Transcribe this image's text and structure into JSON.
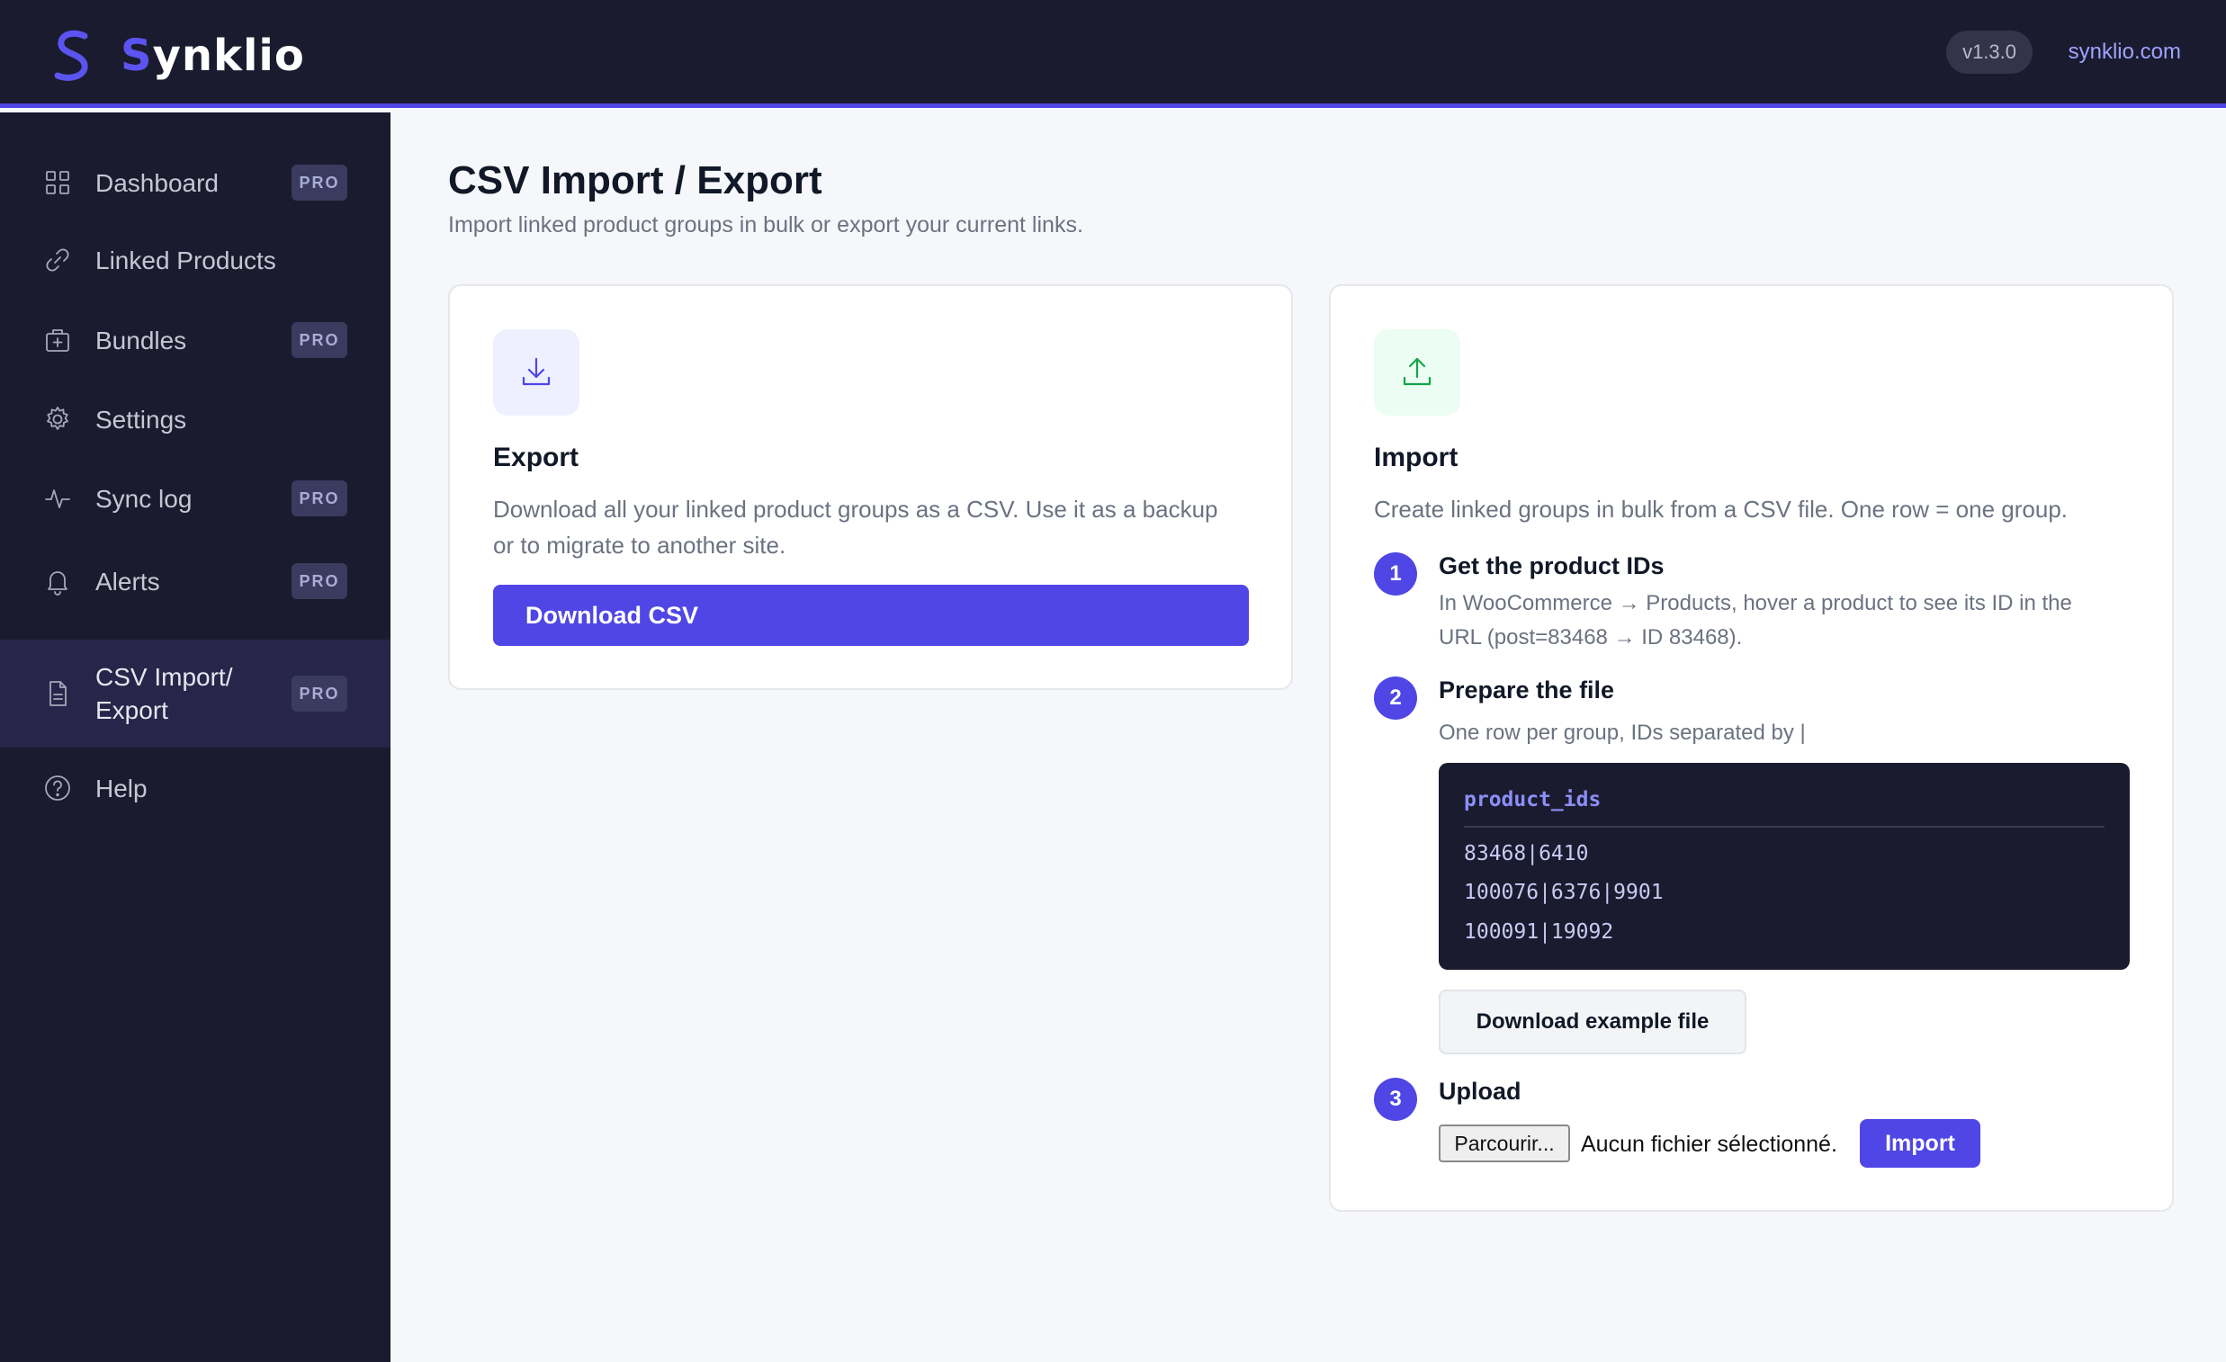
{
  "header": {
    "brand_first": "S",
    "brand_rest": "ynklio",
    "version": "v1.3.0",
    "site_link": "synklio.com"
  },
  "sidebar": {
    "items": [
      {
        "label": "Dashboard",
        "icon": "grid-icon",
        "pro": "PRO"
      },
      {
        "label": "Linked Products",
        "icon": "link-icon",
        "pro": ""
      },
      {
        "label": "Bundles",
        "icon": "box-plus-icon",
        "pro": "PRO"
      },
      {
        "label": "Settings",
        "icon": "gear-icon",
        "pro": ""
      },
      {
        "label": "Sync log",
        "icon": "activity-icon",
        "pro": "PRO"
      },
      {
        "label": "Alerts",
        "icon": "bell-icon",
        "pro": "PRO"
      },
      {
        "label_line1": "CSV Import/",
        "label_line2": "Export",
        "icon": "file-icon",
        "pro": "PRO",
        "active": true
      },
      {
        "label": "Help",
        "icon": "help-circle-icon",
        "pro": ""
      }
    ]
  },
  "main": {
    "title": "CSV Import / Export",
    "subtitle": "Import linked product groups in bulk or export your current links."
  },
  "export_card": {
    "icon": "download-icon",
    "title": "Export",
    "desc_line1": "Download all your linked product groups as a CSV. Use it as a backup",
    "desc_line2": "or to migrate to another site.",
    "button": "Download CSV"
  },
  "import_card": {
    "icon": "upload-icon",
    "title": "Import",
    "desc": "Create linked groups in bulk from a CSV file. One row = one group.",
    "steps": [
      {
        "num": "1",
        "title": "Get the product IDs",
        "text_line1": "In WooCommerce → Products, hover a product to see its ID in the",
        "text_line2": "URL (post=83468 → ID 83468)."
      },
      {
        "num": "2",
        "title": "Prepare the file",
        "text_line1": "One row per group, IDs separated by |"
      },
      {
        "num": "3",
        "title": "Upload"
      }
    ],
    "code": {
      "header": "product_ids",
      "rows": [
        "83468|6410",
        "100076|6376|9901",
        "100091|19092"
      ]
    },
    "example_button": "Download example file",
    "file_button": "Parcourir...",
    "file_status": "Aucun fichier sélectionné.",
    "import_button": "Import"
  },
  "colors": {
    "accent": "#4f46e5",
    "sidebar_bg": "#1b1b2f",
    "page_bg": "#f6f7fb",
    "export_icon_bg": "#eef0ff",
    "import_icon_bg": "#ecfdf3",
    "import_icon_stroke": "#16a34a"
  }
}
